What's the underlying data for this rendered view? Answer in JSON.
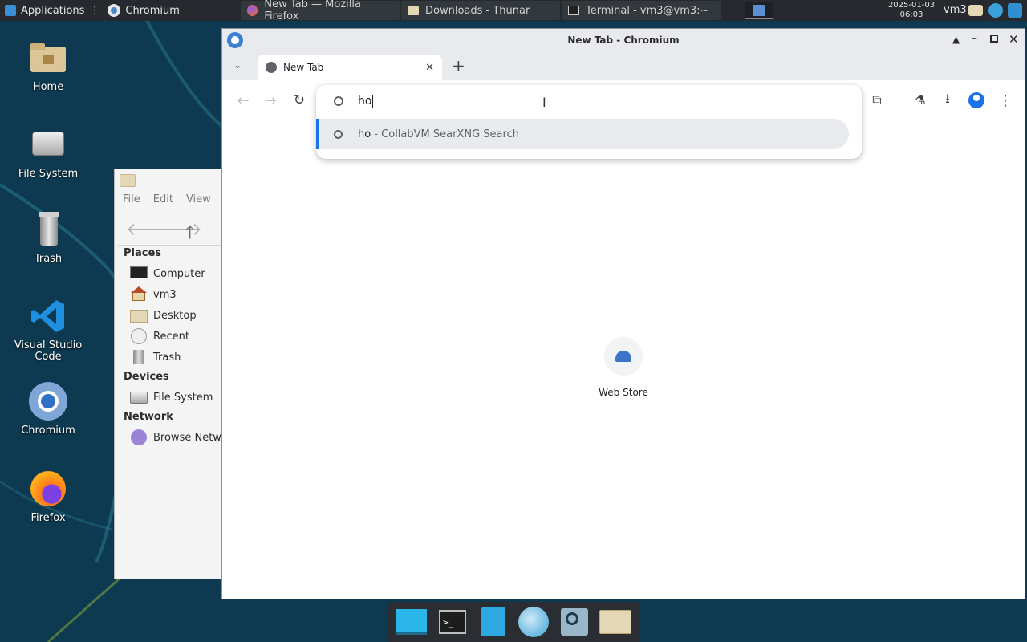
{
  "top_panel": {
    "applications_label": "Applications",
    "active_app_label": "Chromium",
    "tasks": [
      {
        "label": "New Tab — Mozilla Firefox",
        "icon": "firefox-icon"
      },
      {
        "label": "Downloads - Thunar",
        "icon": "folder-icon"
      },
      {
        "label": "Terminal - vm3@vm3:~",
        "icon": "terminal-icon"
      }
    ],
    "clock_date": "2025-01-03",
    "clock_time": "06:03",
    "user": "vm3"
  },
  "desktop_icons": [
    {
      "label": "Home",
      "icon": "home-folder-icon"
    },
    {
      "label": "File System",
      "icon": "drive-icon"
    },
    {
      "label": "Trash",
      "icon": "trash-icon"
    },
    {
      "label": "Visual Studio Code",
      "icon": "vscode-icon"
    },
    {
      "label": "Chromium",
      "icon": "chromium-icon"
    },
    {
      "label": "Firefox",
      "icon": "firefox-icon"
    }
  ],
  "thunar": {
    "menu": [
      "File",
      "Edit",
      "View"
    ],
    "sections": [
      {
        "heading": "Places",
        "items": [
          {
            "label": "Computer",
            "icon": "computer-icon"
          },
          {
            "label": "vm3",
            "icon": "home-icon"
          },
          {
            "label": "Desktop",
            "icon": "folder-icon"
          },
          {
            "label": "Recent",
            "icon": "clock-icon"
          },
          {
            "label": "Trash",
            "icon": "trash-icon"
          }
        ]
      },
      {
        "heading": "Devices",
        "items": [
          {
            "label": "File System",
            "icon": "drive-icon"
          }
        ]
      },
      {
        "heading": "Network",
        "items": [
          {
            "label": "Browse Network",
            "icon": "network-icon"
          }
        ]
      }
    ]
  },
  "chromium": {
    "window_title": "New Tab - Chromium",
    "tab_title": "New Tab",
    "omnibox": {
      "value": "ho",
      "suggestion_query": "ho",
      "suggestion_source": " - CollabVM SearXNG Search"
    },
    "shortcut_label": "Web Store"
  },
  "colors": {
    "desktop": "#0e3b52",
    "panel": "#262a2e",
    "accent_blue": "#1a73e8"
  }
}
